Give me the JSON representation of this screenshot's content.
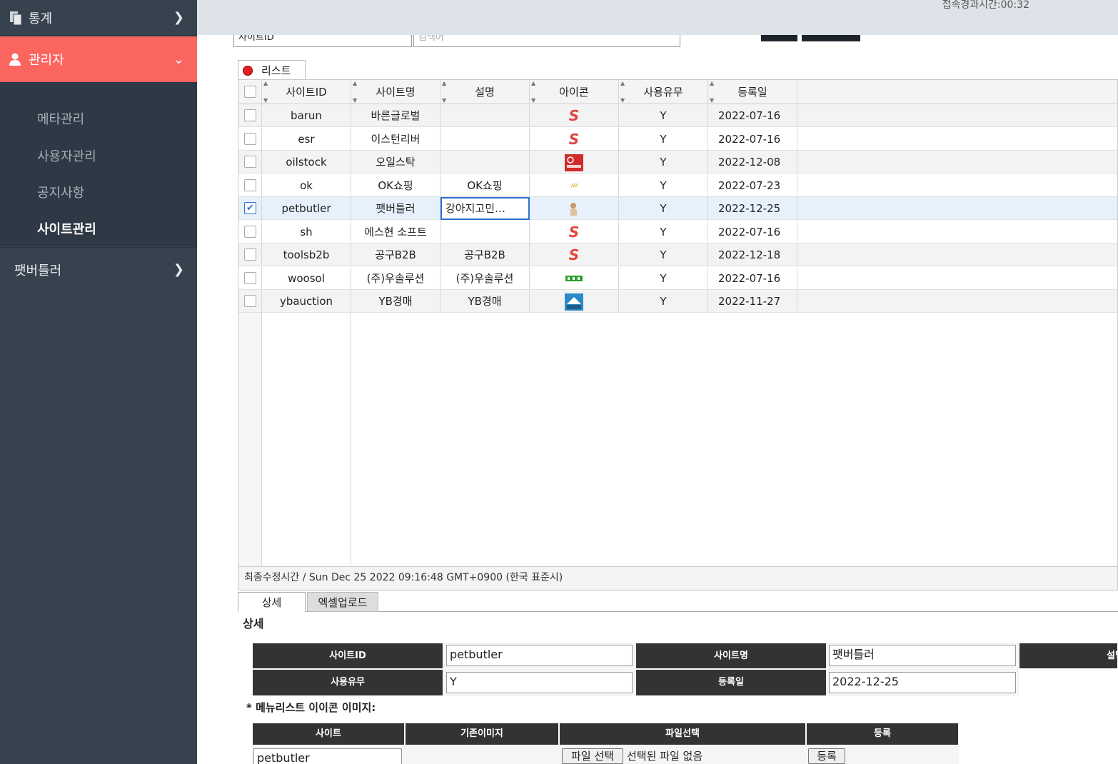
{
  "sidebar": {
    "stats_label": "통계",
    "admin_label": "관리자",
    "sub_items": [
      "메타관리",
      "사용자관리",
      "공지사항",
      "사이트관리"
    ],
    "petbutler_label": "팻버틀러"
  },
  "header": {
    "elapsed": "접속경과시간:00:32"
  },
  "search": {
    "select_value": "사이트ID",
    "input_placeholder": "검색어"
  },
  "list": {
    "tab_label": "리스트",
    "columns": [
      "사이트ID",
      "사이트명",
      "설명",
      "아이콘",
      "사용유무",
      "등록일"
    ],
    "rows": [
      {
        "id": "barun",
        "name": "바른글로벌",
        "desc": "",
        "icon": "s-logo-icon",
        "use": "Y",
        "date": "2022-07-16",
        "checked": false
      },
      {
        "id": "esr",
        "name": "이스턴리버",
        "desc": "",
        "icon": "s-logo-icon",
        "use": "Y",
        "date": "2022-07-16",
        "checked": false
      },
      {
        "id": "oilstock",
        "name": "오일스탁",
        "desc": "",
        "icon": "oilstock-logo-icon",
        "use": "Y",
        "date": "2022-12-08",
        "checked": false
      },
      {
        "id": "ok",
        "name": "OK쇼핑",
        "desc": "OK쇼핑",
        "icon": "ok-logo-icon",
        "use": "Y",
        "date": "2022-07-23",
        "checked": false
      },
      {
        "id": "petbutler",
        "name": "팻버틀러",
        "desc": "강아지고민…",
        "icon": "dog-logo-icon",
        "use": "Y",
        "date": "2022-12-25",
        "checked": true
      },
      {
        "id": "sh",
        "name": "에스현 소프트",
        "desc": "",
        "icon": "s-logo-icon",
        "use": "Y",
        "date": "2022-07-16",
        "checked": false
      },
      {
        "id": "toolsb2b",
        "name": "공구B2B",
        "desc": "공구B2B",
        "icon": "s-logo-icon",
        "use": "Y",
        "date": "2022-12-18",
        "checked": false
      },
      {
        "id": "woosol",
        "name": "(주)우솔루션",
        "desc": "(주)우솔루션",
        "icon": "woo-logo-icon",
        "use": "Y",
        "date": "2022-07-16",
        "checked": false
      },
      {
        "id": "ybauction",
        "name": "YB경매",
        "desc": "YB경매",
        "icon": "yb-logo-icon",
        "use": "Y",
        "date": "2022-11-27",
        "checked": false
      }
    ],
    "footer": "최종수정시간 / Sun Dec 25 2022 09:16:48 GMT+0900 (한국 표준시)"
  },
  "detail": {
    "tabs": [
      "상세",
      "엑셀업로드"
    ],
    "title": "상세",
    "labels": {
      "site_id": "사이트ID",
      "site_name": "사이트명",
      "desc": "설명",
      "use": "사용유무",
      "date": "등록일"
    },
    "values": {
      "site_id": "petbutler",
      "site_name": "팻버틀러",
      "use": "Y",
      "date": "2022-12-25"
    },
    "icon_section_title": "* 메뉴리스트 이이콘 이미지:",
    "icon_table_headers": [
      "사이트",
      "기존이미지",
      "파일선택",
      "등록"
    ],
    "icon_row": {
      "site": "petbutler",
      "file_button": "파일 선택",
      "file_status": "선택된 파일 없음",
      "register_button": "등록"
    }
  },
  "colors": {
    "sidebar_bg": "#37424f",
    "active_menu": "#fb6560",
    "header_bg": "#dde3e8"
  }
}
